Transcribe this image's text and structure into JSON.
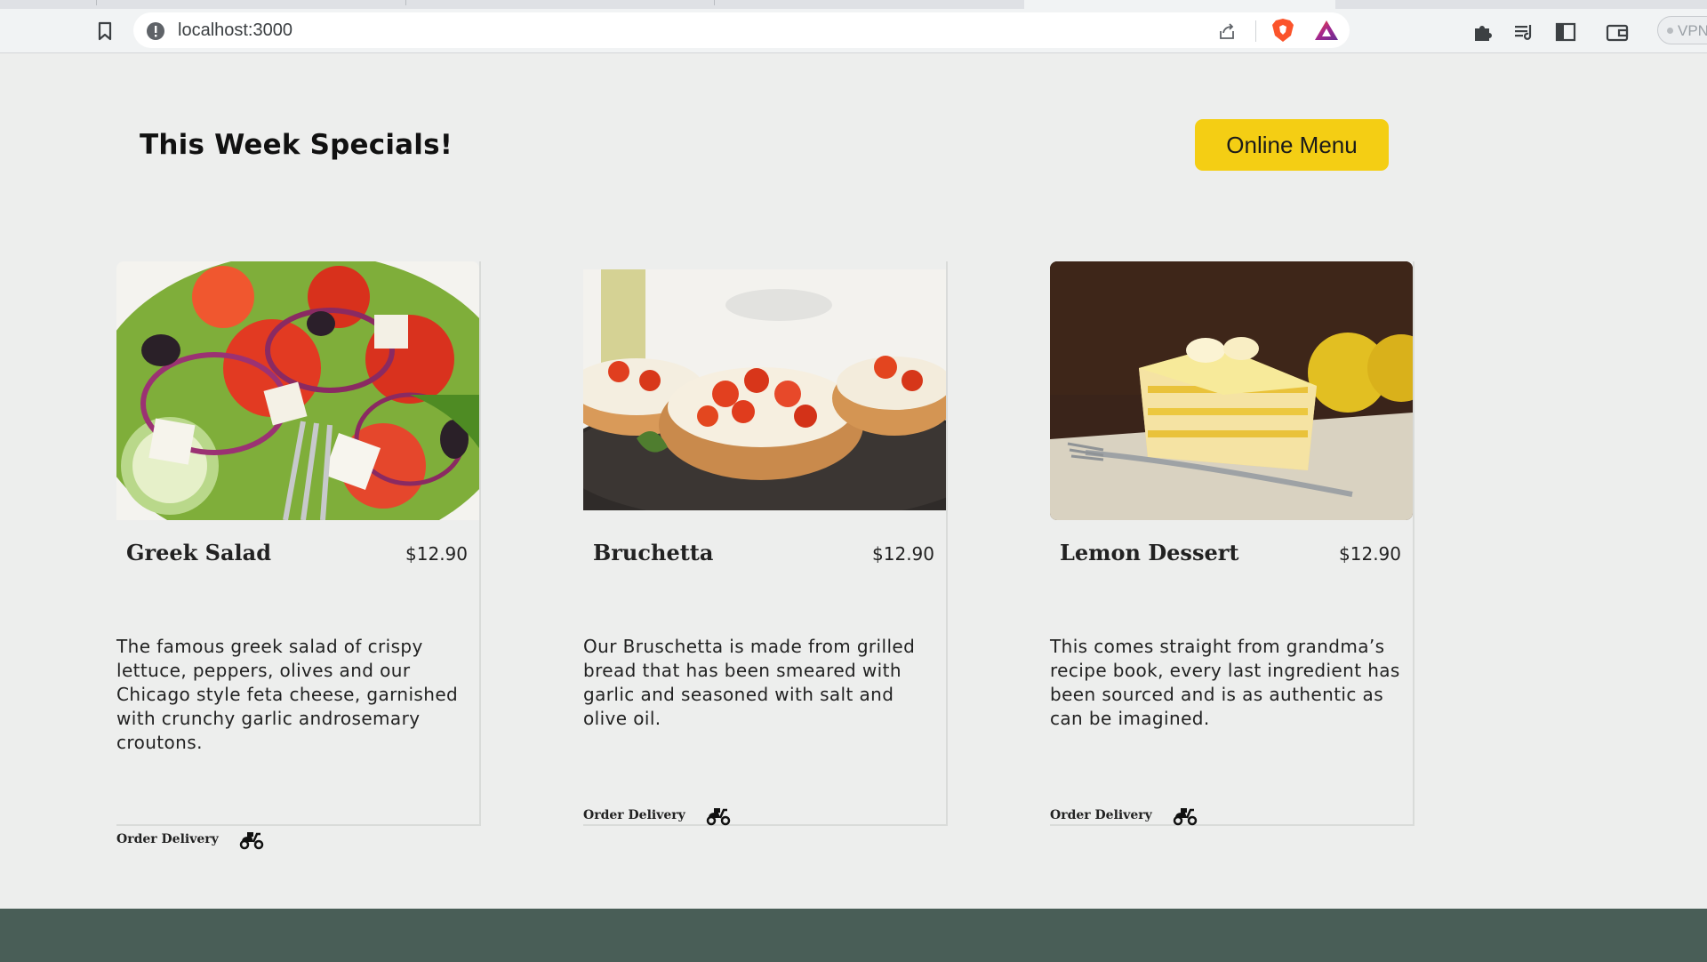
{
  "browser": {
    "url": "localhost:3000",
    "vpn_label": "VPN",
    "icons": [
      "bookmark-icon",
      "site-info-icon",
      "share-icon",
      "brave-shield-icon",
      "brave-rewards-icon",
      "extensions-icon",
      "playlist-icon",
      "sidebar-icon",
      "wallet-icon"
    ]
  },
  "header": {
    "title": "This Week Specials!",
    "menu_button": "Online Menu"
  },
  "cards": [
    {
      "name": "Greek Salad",
      "price": "$12.90",
      "description": "The famous greek salad of crispy lettuce, peppers, olives and our Chicago style feta cheese, garnished with crunchy garlic androsemary croutons.",
      "order_label": "Order Delivery"
    },
    {
      "name": "Bruchetta",
      "price": "$12.90",
      "description": "Our Bruschetta is made from grilled bread that has been smeared with garlic and seasoned with salt and olive oil.",
      "order_label": "Order Delivery"
    },
    {
      "name": "Lemon Dessert",
      "price": "$12.90",
      "description": "This comes straight from grandma’s recipe book, every last ingredient has been sourced and is as authentic as can be imagined.",
      "order_label": "Order Delivery"
    }
  ],
  "colors": {
    "page_bg": "#edeeed",
    "accent_yellow": "#f4ce14",
    "footer_green": "#495e57"
  }
}
